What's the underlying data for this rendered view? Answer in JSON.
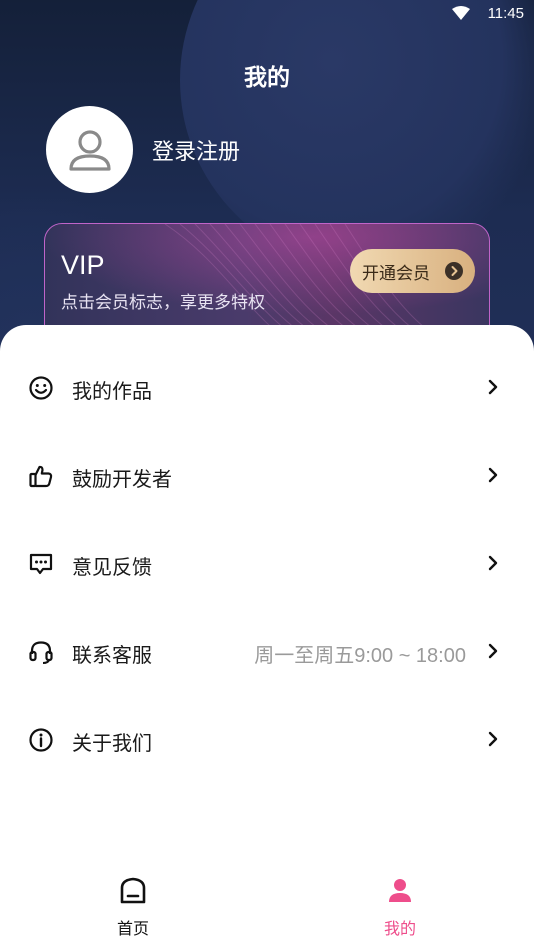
{
  "status_bar": {
    "time": "11:45"
  },
  "header": {
    "title": "我的"
  },
  "profile": {
    "login_label": "登录注册"
  },
  "vip": {
    "title": "VIP",
    "subtitle": "点击会员标志，享更多特权",
    "button_label": "开通会员"
  },
  "menu": {
    "items": [
      {
        "label": "我的作品",
        "icon": "smile-icon",
        "extra": ""
      },
      {
        "label": "鼓励开发者",
        "icon": "thumbs-up-icon",
        "extra": ""
      },
      {
        "label": "意见反馈",
        "icon": "feedback-message-icon",
        "extra": ""
      },
      {
        "label": "联系客服",
        "icon": "headset-icon",
        "extra": "周一至周五9:00 ~ 18:00"
      },
      {
        "label": "关于我们",
        "icon": "info-icon",
        "extra": ""
      }
    ]
  },
  "bottom_nav": {
    "items": [
      {
        "label": "首页",
        "icon": "home-icon",
        "active": false
      },
      {
        "label": "我的",
        "icon": "user-icon",
        "active": true
      }
    ]
  },
  "colors": {
    "accent": "#ee4d8b",
    "header_bg": "#1b2747",
    "vip_border": "#c064c9",
    "vip_button": "#e6c393"
  }
}
